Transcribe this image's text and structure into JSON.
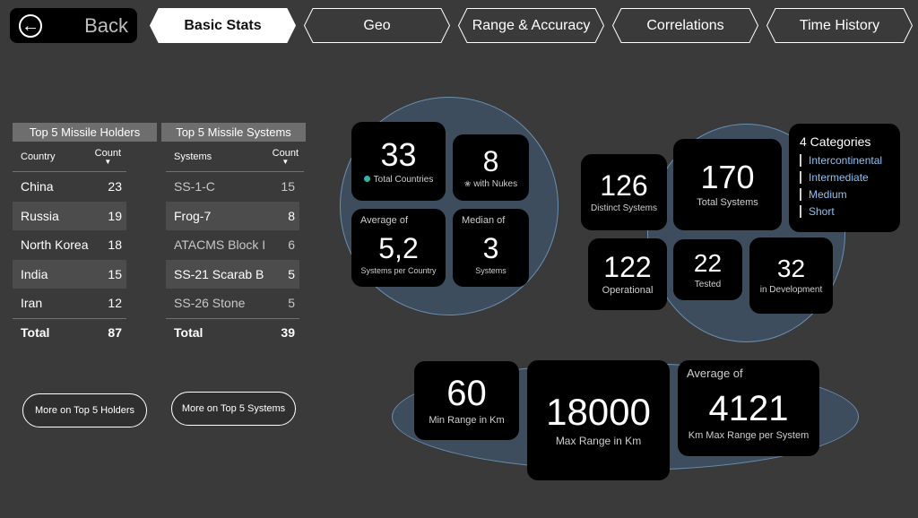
{
  "nav": {
    "back_label": "Back",
    "tabs": [
      {
        "label": "Basic Stats",
        "active": true
      },
      {
        "label": "Geo",
        "active": false
      },
      {
        "label": "Range & Accuracy",
        "active": false
      },
      {
        "label": "Correlations",
        "active": false
      },
      {
        "label": "Time History",
        "active": false
      }
    ]
  },
  "holders_table": {
    "title": "Top 5 Missile Holders",
    "col_name": "Country",
    "col_count": "Count",
    "rows": [
      {
        "name": "China",
        "count": "23"
      },
      {
        "name": "Russia",
        "count": "19"
      },
      {
        "name": "North Korea",
        "count": "18"
      },
      {
        "name": "India",
        "count": "15"
      },
      {
        "name": "Iran",
        "count": "12"
      }
    ],
    "total_label": "Total",
    "total_value": "87",
    "button_label": "More on Top 5 Holders"
  },
  "systems_table": {
    "title": "Top 5 Missile Systems",
    "col_name": "Systems",
    "col_count": "Count",
    "rows": [
      {
        "name": "SS-1-C",
        "count": "15"
      },
      {
        "name": "Frog-7",
        "count": "8"
      },
      {
        "name": "ATACMS Block I",
        "count": "6"
      },
      {
        "name": "SS-21 Scarab B",
        "count": "5"
      },
      {
        "name": "SS-26 Stone",
        "count": "5"
      }
    ],
    "total_label": "Total",
    "total_value": "39",
    "button_label": "More on Top 5 Systems"
  },
  "country_stats": {
    "total_countries": {
      "value": "33",
      "label": "Total Countries"
    },
    "with_nukes": {
      "value": "8",
      "label": "with Nukes"
    },
    "avg_systems": {
      "prefix": "Average of",
      "value": "5,2",
      "label": "Systems per Country"
    },
    "median_systems": {
      "prefix": "Median of",
      "value": "3",
      "label": "Systems"
    }
  },
  "system_stats": {
    "distinct": {
      "value": "126",
      "label": "Distinct Systems"
    },
    "total": {
      "value": "170",
      "label": "Total Systems"
    },
    "operational": {
      "value": "122",
      "label": "Operational"
    },
    "tested": {
      "value": "22",
      "label": "Tested"
    },
    "in_dev": {
      "value": "32",
      "label": "in Development"
    },
    "categories": {
      "title": "4 Categories",
      "items": [
        "Intercontinental",
        "Intermediate",
        "Medium",
        "Short"
      ]
    }
  },
  "range_stats": {
    "min": {
      "value": "60",
      "label": "Min Range in Km"
    },
    "max": {
      "value": "18000",
      "label": "Max Range in Km"
    },
    "avg": {
      "prefix": "Average of",
      "value": "4121",
      "label": "Km Max Range per System"
    }
  },
  "colors": {
    "bubble_fill": "#3d4d5d",
    "bubble_border": "#6b8eb0",
    "category_text": "#8ec0f0",
    "accent_line": "#4d7aa3"
  }
}
